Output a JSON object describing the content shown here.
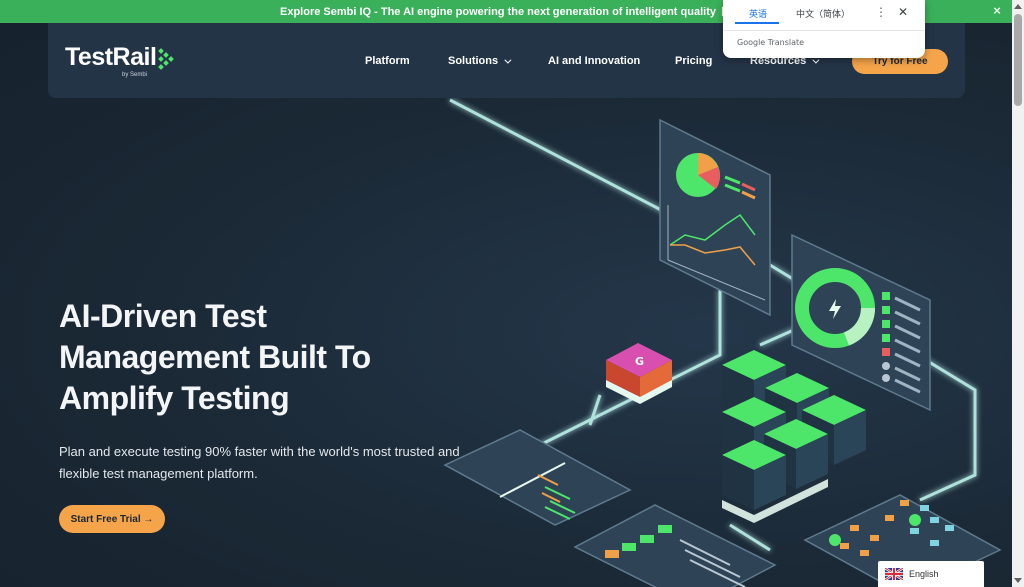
{
  "promo": {
    "text": "Explore Sembi IQ - The AI engine powering the next generation of intelligent quality",
    "close": "×"
  },
  "nav": {
    "logo": "TestRail",
    "logo_sub": "by Sembi",
    "links": [
      "Platform",
      "Solutions",
      "AI and Innovation",
      "Pricing",
      "Resources"
    ],
    "cta": "Try for Free"
  },
  "hero": {
    "title": "AI-Driven Test Management Built To Amplify Testing",
    "subtitle": "Plan and execute testing 90% faster with the world's most trusted and flexible test management platform.",
    "cta": "Start Free Trial →"
  },
  "translate": {
    "tab_source": "英语",
    "tab_target": "中文（简体）",
    "more": "⋮",
    "close": "✕",
    "brand": "Google Translate"
  },
  "language_widget": {
    "label": "English"
  },
  "colors": {
    "promo": "#3bb05a",
    "accent": "#f5a44a",
    "nav": "#243447",
    "background": "#1a2733",
    "green": "#4ee66a"
  }
}
